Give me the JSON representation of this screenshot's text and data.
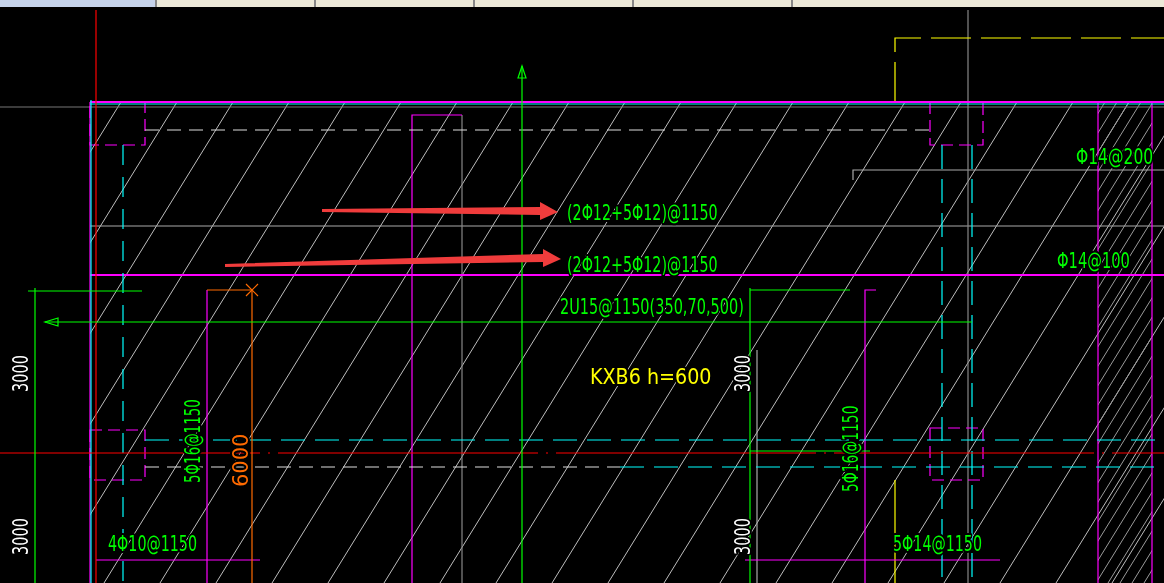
{
  "labels": [
    {
      "text": "(2Φ12+5Φ12)@1150",
      "kind": "rebar",
      "vertical": false
    },
    {
      "text": "(2Φ12+5Φ12)@1150",
      "kind": "rebar",
      "vertical": false
    },
    {
      "text": "2U15@1150(350,70,500)",
      "kind": "rebar",
      "vertical": false
    },
    {
      "text": "Φ14@200",
      "kind": "rebar",
      "vertical": false
    },
    {
      "text": "Φ14@100",
      "kind": "rebar",
      "vertical": false
    },
    {
      "text": "KXB6 h=600",
      "kind": "slab",
      "vertical": false
    },
    {
      "text": "5Φ16@1150",
      "kind": "rebar",
      "vertical": true
    },
    {
      "text": "6000",
      "kind": "length",
      "vertical": true
    },
    {
      "text": "3000",
      "kind": "dimension",
      "vertical": true
    },
    {
      "text": "3000",
      "kind": "dimension",
      "vertical": true
    },
    {
      "text": "3000",
      "kind": "dimension",
      "vertical": true
    },
    {
      "text": "3000",
      "kind": "dimension",
      "vertical": true
    },
    {
      "text": "5Φ16@1150",
      "kind": "rebar",
      "vertical": true
    },
    {
      "text": "4Φ10@1150",
      "kind": "rebar",
      "vertical": false
    },
    {
      "text": "5Φ14@1150",
      "kind": "rebar",
      "vertical": false
    }
  ]
}
